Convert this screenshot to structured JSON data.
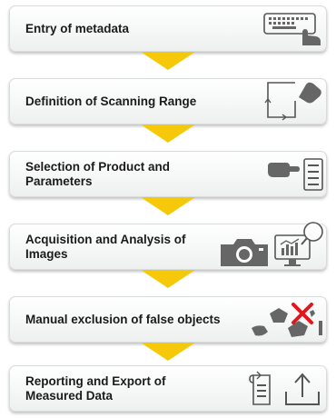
{
  "accent_color": "#f6c80a",
  "steps": [
    {
      "label": "Entry of metadata",
      "icons": [
        "keyboard-hand-icon"
      ]
    },
    {
      "label": "Definition of Scanning Range",
      "icons": [
        "scan-range-hand-icon"
      ]
    },
    {
      "label": "Selection of Product and Parameters",
      "icons": [
        "pointing-hand-checklist-icon"
      ]
    },
    {
      "label": "Acquisition and Analysis of Images",
      "icons": [
        "camera-icon",
        "monitor-chart-magnifier-icon"
      ]
    },
    {
      "label": "Manual exclusion of false objects",
      "icons": [
        "particles-red-x-icon"
      ]
    },
    {
      "label": "Reporting and Export of Measured Data",
      "icons": [
        "report-document-icon",
        "upload-export-icon"
      ]
    }
  ]
}
